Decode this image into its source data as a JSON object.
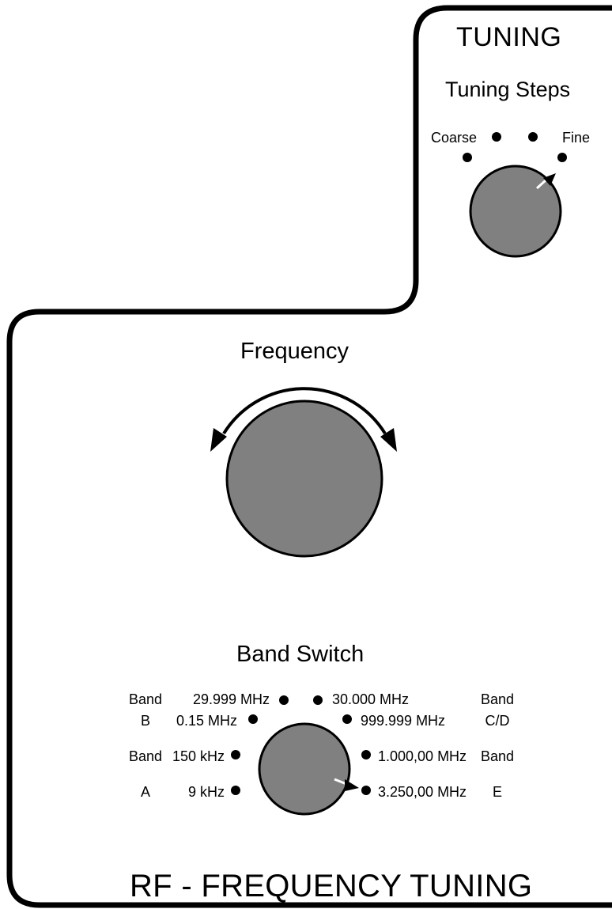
{
  "tuning": {
    "title": "TUNING",
    "steps_title": "Tuning Steps",
    "coarse_label": "Coarse",
    "fine_label": "Fine",
    "step_count": 4,
    "selected_step": "Fine"
  },
  "frequency": {
    "title": "Frequency"
  },
  "band_switch": {
    "title": "Band Switch",
    "selected": "3.250,00 MHz",
    "left_positions": [
      "29.999 MHz",
      "0.15 MHz",
      "150 kHz",
      "9 kHz"
    ],
    "right_positions": [
      "30.000 MHz",
      "999.999 MHz",
      "1.000,00 MHz",
      "3.250,00 MHz"
    ],
    "band_labels": {
      "b_word": "Band",
      "b_letter": "B",
      "a_word": "Band",
      "a_letter": "A",
      "cd_word": "Band",
      "cd_letter": "C/D",
      "e_word": "Band",
      "e_letter": "E"
    }
  },
  "footer": {
    "title": "RF - FREQUENCY TUNING"
  },
  "colors": {
    "knob_fill": "#808080",
    "outline": "#000000",
    "pointer": "#ffffff"
  }
}
